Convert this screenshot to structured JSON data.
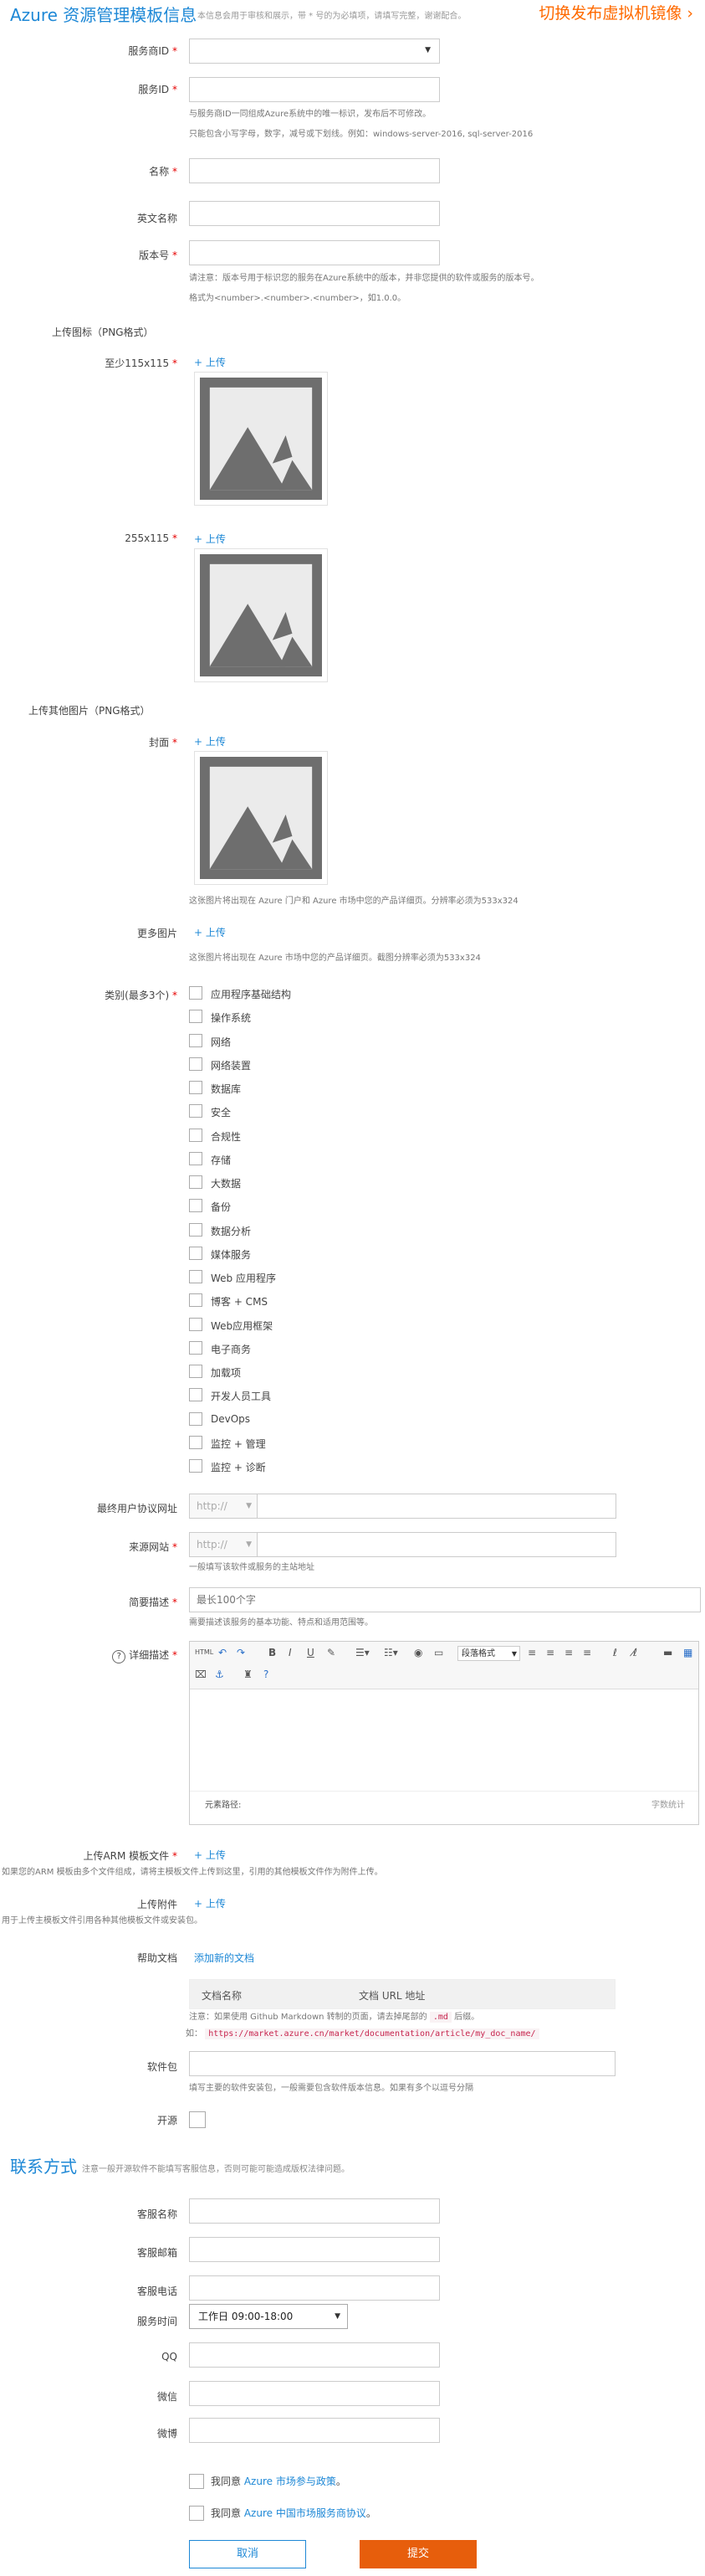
{
  "header": {
    "title": "Azure 资源管理模板信息",
    "subtitle": "本信息会用于审核和展示，带 * 号的为必填项，请填写完整，谢谢配合。",
    "switch_link": "切换发布虚拟机镜像 ›"
  },
  "fields": {
    "publisher_id": {
      "label": "服务商ID",
      "value": ""
    },
    "service_id": {
      "label": "服务ID",
      "value": "",
      "help1": "与服务商ID一同组成Azure系统中的唯一标识，发布后不可修改。",
      "help2": "只能包含小写字母，数字，减号或下划线。例如：windows-server-2016, sql-server-2016"
    },
    "name": {
      "label": "名称",
      "value": ""
    },
    "english_name": {
      "label": "英文名称",
      "value": ""
    },
    "version": {
      "label": "版本号",
      "value": "",
      "help1": "请注意：版本号用于标识您的服务在Azure系统中的版本，并非您提供的软件或服务的版本号。",
      "help2": "格式为<number>.<number>.<number>，如1.0.0。"
    }
  },
  "upload_icon": {
    "section": "上传图标（PNG格式）",
    "small_label": "至少115x115",
    "wide_label": "255x115",
    "upload_text": "+ 上传"
  },
  "other_images": {
    "section": "上传其他图片（PNG格式）",
    "cover_label": "封面",
    "cover_help": "这张图片将出现在 Azure 门户和 Azure 市场中您的产品详细页。分辨率必须为533x324",
    "more_label": "更多图片",
    "more_help": "这张图片将出现在 Azure 市场中您的产品详细页。截图分辨率必须为533x324",
    "upload_text": "+ 上传"
  },
  "categories": {
    "label": "类别(最多3个)",
    "items": [
      "应用程序基础结构",
      "操作系统",
      "网络",
      "网络装置",
      "数据库",
      "安全",
      "合规性",
      "存储",
      "大数据",
      "备份",
      "数据分析",
      "媒体服务",
      "Web 应用程序",
      "博客 + CMS",
      "Web应用框架",
      "电子商务",
      "加载项",
      "开发人员工具",
      "DevOps",
      "监控 + 管理",
      "监控 + 诊断"
    ]
  },
  "eula": {
    "label": "最终用户协议网址",
    "prefix": "http://",
    "value": ""
  },
  "website": {
    "label": "来源网站",
    "prefix": "http://",
    "value": "",
    "help": "一般填写该软件或服务的主站地址"
  },
  "short_desc": {
    "label": "简要描述",
    "placeholder": "最长100个字",
    "help": "需要描述该服务的基本功能、特点和适用范围等。"
  },
  "detail_desc": {
    "label": "详细描述",
    "format_select": "段落格式",
    "path_label": "元素路径:",
    "word_count": "字数统计"
  },
  "arm_file": {
    "label": "上传ARM 模板文件",
    "upload_text": "+ 上传",
    "help": "如果您的ARM 模板由多个文件组成，请将主模板文件上传到这里，引用的其他模板文件作为附件上传。"
  },
  "attachment": {
    "label": "上传附件",
    "upload_text": "+ 上传",
    "help": "用于上传主模板文件引用各种其他模板文件或安装包。"
  },
  "help_docs": {
    "label": "帮助文档",
    "add_link": "添加新的文档",
    "col_name": "文档名称",
    "col_url": "文档 URL 地址",
    "note_prefix": "注意：如果使用 Github Markdown 转制的页面，请去掉尾部的",
    "note_code": ".md",
    "note_suffix": "后缀。",
    "example_prefix": "如：",
    "example_code": "https://market.azure.cn/market/documentation/article/my_doc_name/"
  },
  "package": {
    "label": "软件包",
    "value": "",
    "help": "填写主要的软件安装包，一般需要包含软件版本信息。如果有多个以逗号分隔"
  },
  "open_source": {
    "label": "开源"
  },
  "contact": {
    "title": "联系方式",
    "subtitle": "注意一般开源软件不能填写客服信息，否则可能可能造成版权法律问题。",
    "support_name": "客服名称",
    "support_email": "客服邮箱",
    "support_phone": "客服电话",
    "service_time": "服务时间",
    "service_time_value": "工作日 09:00-18:00",
    "qq": "QQ",
    "wechat": "微信",
    "weibo": "微博"
  },
  "agreements": {
    "prefix": "我同意",
    "item1_link": "Azure 市场参与政策",
    "item1_end": "。",
    "item2_link": "Azure 中国市场服务商协议",
    "item2_end": "。"
  },
  "buttons": {
    "cancel": "取消",
    "submit": "提交"
  },
  "colors": {
    "accent": "#1e88d6",
    "orange": "#ff6a00",
    "submit_bg": "#e75e0c",
    "required": "#e60000"
  }
}
